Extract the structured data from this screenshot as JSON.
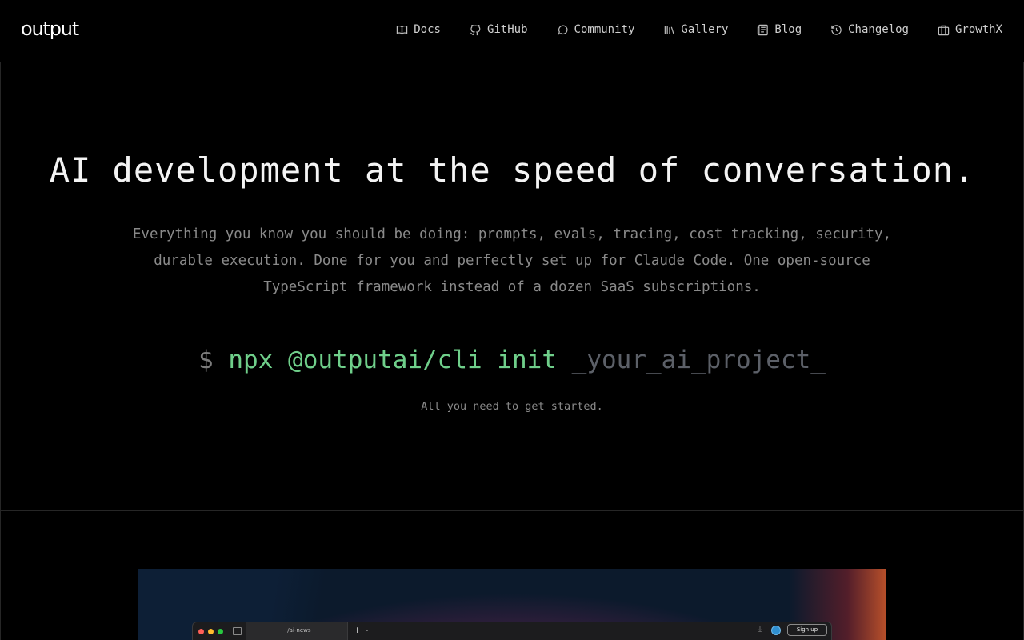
{
  "header": {
    "logo": "output",
    "nav": [
      {
        "label": "Docs",
        "icon": "book-open-icon"
      },
      {
        "label": "GitHub",
        "icon": "github-icon"
      },
      {
        "label": "Community",
        "icon": "chat-bubble-icon"
      },
      {
        "label": "Gallery",
        "icon": "library-icon"
      },
      {
        "label": "Blog",
        "icon": "newspaper-icon"
      },
      {
        "label": "Changelog",
        "icon": "history-icon"
      },
      {
        "label": "GrowthX",
        "icon": "briefcase-icon"
      }
    ]
  },
  "hero": {
    "title": "AI development at the speed of conversation.",
    "subtitle": "Everything you know you should be doing: prompts, evals, tracing, cost tracking, security, durable execution. Done for you and perfectly set up for Claude Code. One open-source TypeScript framework instead of a dozen SaaS subscriptions.",
    "command": {
      "prompt": "$",
      "code": "npx @outputai/cli init",
      "argument": "_your_ai_project_"
    },
    "caption": "All you need to get started."
  },
  "preview": {
    "tab_label": "~/ai-news",
    "new_tab_symbol": "+",
    "chevron": "⌄",
    "download_symbol": "⤓",
    "signup_label": "Sign up"
  },
  "colors": {
    "background": "#000000",
    "command_green": "#6fcf8a",
    "muted_text": "#8a8a8a",
    "border": "#262626"
  }
}
